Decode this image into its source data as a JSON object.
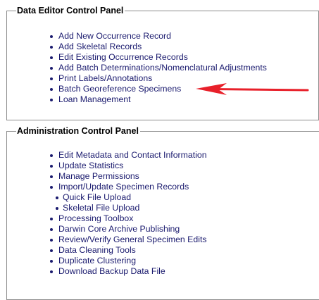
{
  "data_editor_panel": {
    "title": "Data Editor Control Panel",
    "items": [
      {
        "label": "Add New Occurrence Record"
      },
      {
        "label": "Add Skeletal Records"
      },
      {
        "label": "Edit Existing Occurrence Records"
      },
      {
        "label": "Add Batch Determinations/Nomenclatural Adjustments"
      },
      {
        "label": "Print Labels/Annotations"
      },
      {
        "label": "Batch Georeference Specimens"
      },
      {
        "label": "Loan Management"
      }
    ]
  },
  "admin_panel": {
    "title": "Administration Control Panel",
    "items": [
      {
        "label": "Edit Metadata and Contact Information"
      },
      {
        "label": "Update Statistics"
      },
      {
        "label": "Manage Permissions"
      },
      {
        "label": "Import/Update Specimen Records"
      },
      {
        "label": "Quick File Upload"
      },
      {
        "label": "Skeletal File Upload"
      },
      {
        "label": "Processing Toolbox"
      },
      {
        "label": "Darwin Core Archive Publishing"
      },
      {
        "label": "Review/Verify General Specimen Edits"
      },
      {
        "label": "Data Cleaning Tools"
      },
      {
        "label": "Duplicate Clustering"
      },
      {
        "label": "Download Backup Data File"
      }
    ]
  },
  "annotation": {
    "arrow_color": "#e8202a",
    "arrow_icon": "red-arrow-pointer"
  },
  "colors": {
    "link_text": "#1a1a6e",
    "panel_border": "#8c8c8c",
    "title_text": "#000000"
  }
}
